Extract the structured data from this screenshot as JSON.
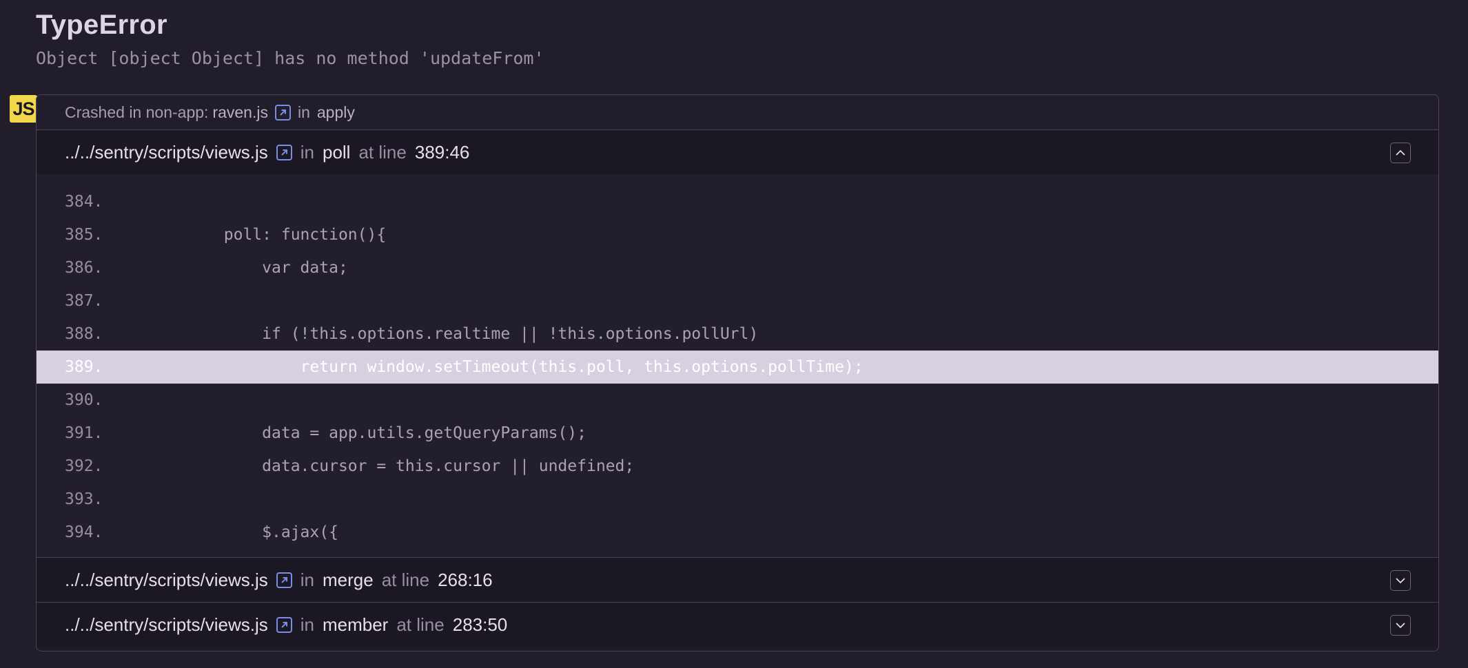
{
  "error": {
    "type": "TypeError",
    "message": "Object [object Object] has no method 'updateFrom'"
  },
  "platform": {
    "badge": "JS",
    "color": "#f2d74b"
  },
  "crash": {
    "prefix": "Crashed in non-app:",
    "file": "raven.js",
    "in_word": "in",
    "function": "apply"
  },
  "frames": [
    {
      "path": "../../sentry/scripts/views.js",
      "in_word": "in",
      "function": "poll",
      "at_line_word": "at line",
      "location": "389:46",
      "expanded": true,
      "code": [
        {
          "num": "384.",
          "src": ""
        },
        {
          "num": "385.",
          "src": "        poll: function(){"
        },
        {
          "num": "386.",
          "src": "            var data;"
        },
        {
          "num": "387.",
          "src": ""
        },
        {
          "num": "388.",
          "src": "            if (!this.options.realtime || !this.options.pollUrl)"
        },
        {
          "num": "389.",
          "src": "                return window.setTimeout(this.poll, this.options.pollTime);",
          "active": true
        },
        {
          "num": "390.",
          "src": ""
        },
        {
          "num": "391.",
          "src": "            data = app.utils.getQueryParams();"
        },
        {
          "num": "392.",
          "src": "            data.cursor = this.cursor || undefined;"
        },
        {
          "num": "393.",
          "src": ""
        },
        {
          "num": "394.",
          "src": "            $.ajax({"
        }
      ]
    },
    {
      "path": "../../sentry/scripts/views.js",
      "in_word": "in",
      "function": "merge",
      "at_line_word": "at line",
      "location": "268:16",
      "expanded": false
    },
    {
      "path": "../../sentry/scripts/views.js",
      "in_word": "in",
      "function": "member",
      "at_line_word": "at line",
      "location": "283:50",
      "expanded": false
    }
  ],
  "colors": {
    "background": "#221d2b",
    "link_icon": "#7a8de6",
    "highlight": "#d6d0e0"
  }
}
